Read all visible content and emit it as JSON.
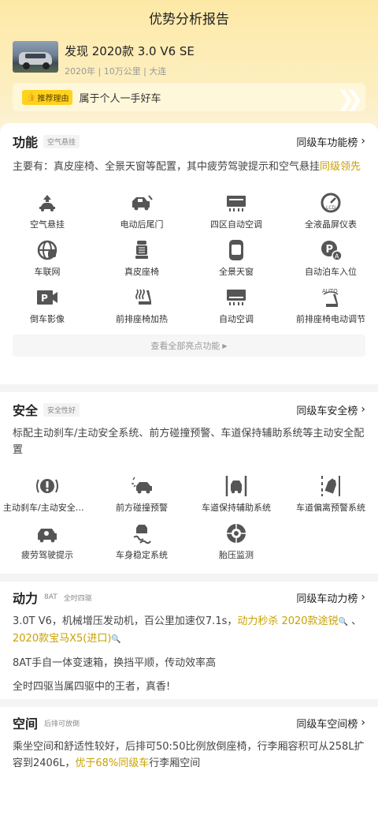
{
  "header": {
    "title": "优势分析报告"
  },
  "car": {
    "name": "发现 2020款 3.0 V6 SE",
    "meta": "2020年 | 10万公里 | 大连"
  },
  "reason": {
    "badge": "推荐理由",
    "text": "属于个人一手好车"
  },
  "function": {
    "title": "功能",
    "tag": "空气悬挂",
    "rank": "同级车功能榜",
    "desc_prefix": "主要有：真皮座椅、全景天窗等配置，其中疲劳驾驶提示和空气悬挂",
    "desc_highlight": "同级领先",
    "items": [
      {
        "label": "空气悬挂",
        "icon": "air-suspension-icon"
      },
      {
        "label": "电动后尾门",
        "icon": "power-tailgate-icon"
      },
      {
        "label": "四区自动空调",
        "icon": "four-zone-ac-icon"
      },
      {
        "label": "全液晶屏仪表",
        "icon": "lcd-gauge-icon"
      },
      {
        "label": "车联网",
        "icon": "connectivity-icon"
      },
      {
        "label": "真皮座椅",
        "icon": "leather-seat-icon"
      },
      {
        "label": "全景天窗",
        "icon": "panoramic-roof-icon"
      },
      {
        "label": "自动泊车入位",
        "icon": "auto-park-icon"
      },
      {
        "label": "倒车影像",
        "icon": "reverse-camera-icon"
      },
      {
        "label": "前排座椅加热",
        "icon": "seat-heating-icon"
      },
      {
        "label": "自动空调",
        "icon": "auto-ac-icon"
      },
      {
        "label": "前排座椅电动调节",
        "icon": "power-seat-icon"
      }
    ],
    "more": "查看全部亮点功能"
  },
  "safety": {
    "title": "安全",
    "tag": "安全性好",
    "rank": "同级车安全榜",
    "desc": "标配主动刹车/主动安全系统、前方碰撞预警、车道保持辅助系统等主动安全配置",
    "items": [
      {
        "label": "主动刹车/主动安全系统",
        "icon": "active-brake-icon"
      },
      {
        "label": "前方碰撞预警",
        "icon": "collision-warning-icon"
      },
      {
        "label": "车道保持辅助系统",
        "icon": "lane-keep-icon"
      },
      {
        "label": "车道偏离预警系统",
        "icon": "lane-departure-icon"
      },
      {
        "label": "疲劳驾驶提示",
        "icon": "fatigue-alert-icon"
      },
      {
        "label": "车身稳定系统",
        "icon": "stability-control-icon"
      },
      {
        "label": "胎压监测",
        "icon": "tire-pressure-icon"
      }
    ]
  },
  "power": {
    "title": "动力",
    "tag1": "8AT",
    "tag2": "全时四驱",
    "rank": "同级车动力榜",
    "line1_prefix": "3.0T V6，机械增压发动机，百公里加速仅7.1s，",
    "line1_hl1": "动力秒杀 2020款途锐",
    "line1_sep": " 、",
    "line1_hl2": "2020款宝马X5(进口)",
    "line2": "8AT手自一体变速箱，换挡平顺，传动效率高",
    "line3": "全时四驱当属四驱中的王者，真香!"
  },
  "space": {
    "title": "空间",
    "tag": "后排可放倒",
    "rank": "同级车空间榜",
    "desc_prefix": "乘坐空间和舒适性较好，后排可50:50比例放倒座椅，行李厢容积可从258L扩容到2406L，",
    "desc_highlight": "优于68%同级车",
    "desc_suffix": "行李厢空间"
  },
  "colors": {
    "accent": "#ffd21e",
    "highlight": "#c9a000",
    "hero": "#fde9a6"
  }
}
